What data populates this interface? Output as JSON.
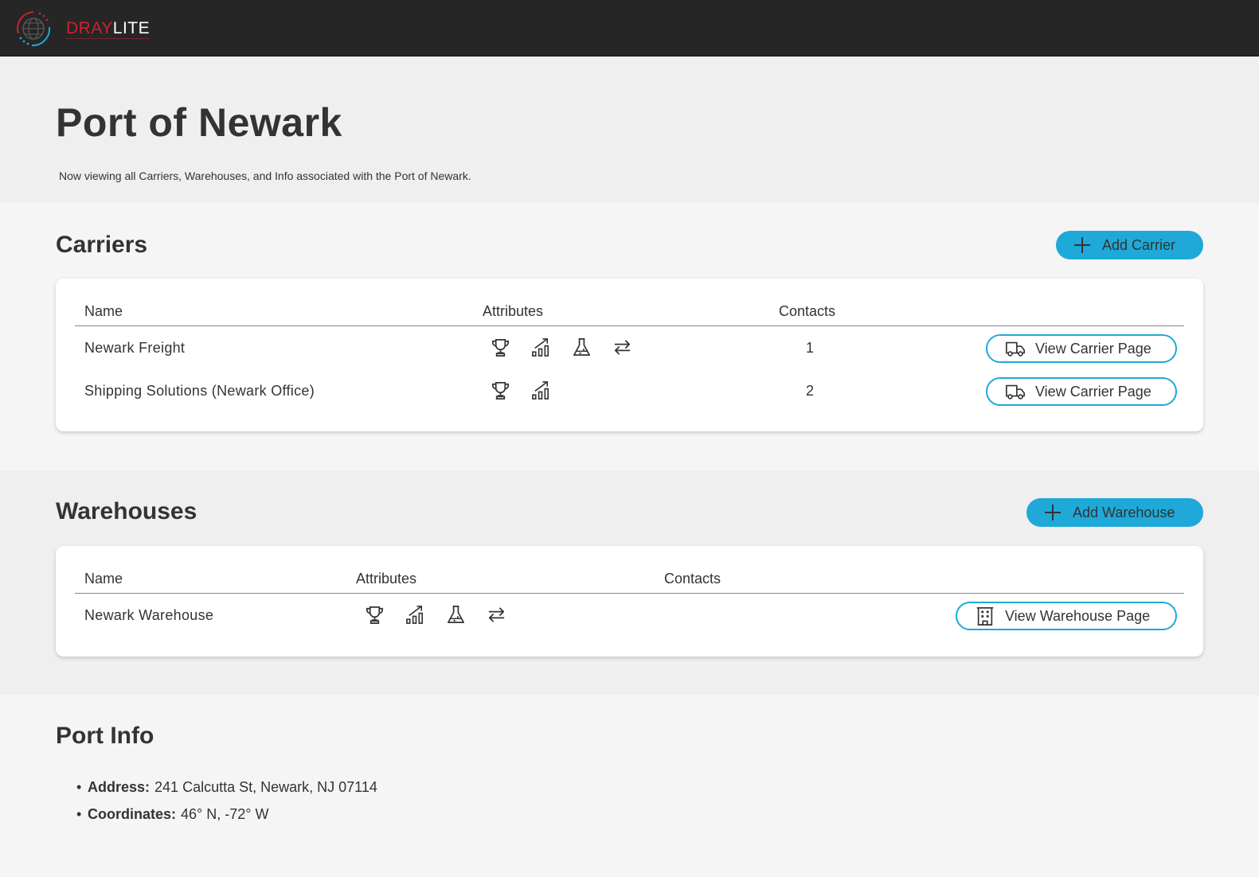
{
  "app": {
    "brand_part1": "DRAY",
    "brand_part2": "LITE",
    "brand_colors": {
      "red": "#d0202e",
      "cyan": "#1ea9d8",
      "topbar": "#262626"
    }
  },
  "hero": {
    "title": "Port of Newark",
    "subtitle": "Now viewing all Carriers, Warehouses, and Info associated with the Port of Newark."
  },
  "carriers": {
    "title": "Carriers",
    "add_label": "Add Carrier",
    "headers": {
      "name": "Name",
      "attributes": "Attributes",
      "contacts": "Contacts"
    },
    "rows": [
      {
        "name": "Newark Freight",
        "attributes": [
          "trophy-icon",
          "growth-chart-icon",
          "flask-icon",
          "swap-arrows-icon"
        ],
        "contacts": "1",
        "button_label": "View Carrier Page",
        "button_icon": "truck-icon"
      },
      {
        "name": "Shipping Solutions (Newark Office)",
        "attributes": [
          "trophy-icon",
          "growth-chart-icon"
        ],
        "contacts": "2",
        "button_label": "View Carrier Page",
        "button_icon": "truck-icon"
      }
    ]
  },
  "warehouses": {
    "title": "Warehouses",
    "add_label": "Add Warehouse",
    "headers": {
      "name": "Name",
      "attributes": "Attributes",
      "contacts": "Contacts"
    },
    "rows": [
      {
        "name": "Newark Warehouse",
        "attributes": [
          "trophy-icon",
          "growth-chart-icon",
          "flask-icon",
          "swap-arrows-icon"
        ],
        "contacts": "",
        "button_label": "View Warehouse Page",
        "button_icon": "building-icon"
      }
    ]
  },
  "port_info": {
    "title": "Port Info",
    "items": [
      {
        "label": "Address:",
        "value": "241 Calcutta St, Newark, NJ 07114"
      },
      {
        "label": "Coordinates:",
        "value": "46° N, -72° W"
      }
    ]
  }
}
